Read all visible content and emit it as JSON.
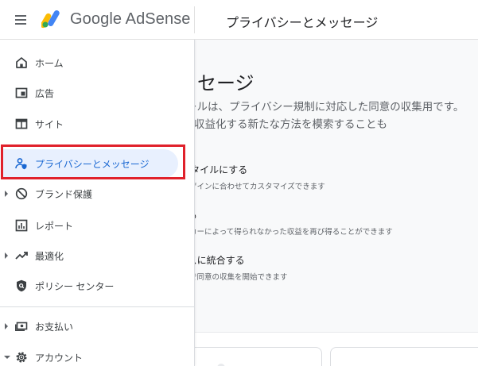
{
  "header": {
    "brand": "Google AdSense",
    "page_title": "プライバシーとメッセージ"
  },
  "sidebar": {
    "items": [
      {
        "label": "ホーム",
        "icon": "home-icon"
      },
      {
        "label": "広告",
        "icon": "ads-icon"
      },
      {
        "label": "サイト",
        "icon": "sites-icon"
      },
      {
        "label": "プライバシーとメッセージ",
        "icon": "privacy-icon",
        "active": true
      },
      {
        "label": "ブランド保護",
        "icon": "block-icon",
        "expandable": true
      },
      {
        "label": "レポート",
        "icon": "reports-icon"
      },
      {
        "label": "最適化",
        "icon": "trending-up-icon",
        "expandable": true
      },
      {
        "label": "ポリシー センター",
        "icon": "policy-shield-icon"
      },
      {
        "label": "お支払い",
        "icon": "payments-icon",
        "expandable": true
      },
      {
        "label": "アカウント",
        "icon": "settings-icon",
        "expandable": true
      }
    ]
  },
  "main": {
    "title": "メッセージ",
    "description": "ージ ツールは、プライバシー規制に対応した同意の収集用です。サイトを収益化する新たな方法を模索することも",
    "features": [
      {
        "title": "ージ スタイルにする",
        "subtitle": "イトのデザインに合わせてカスタマイズできます"
      },
      {
        "title": "保護する",
        "subtitle": "告ブロッカーによって得られなかった収益を再び得ることができます"
      },
      {
        "title": "ームレスに統合する",
        "subtitle": "クリックで同意の収集を開始できます"
      }
    ]
  },
  "colors": {
    "active_bg": "#e8f0fe",
    "active_text": "#1967d2",
    "highlight": "#e0212b",
    "main_bg": "#f8f9fa"
  }
}
